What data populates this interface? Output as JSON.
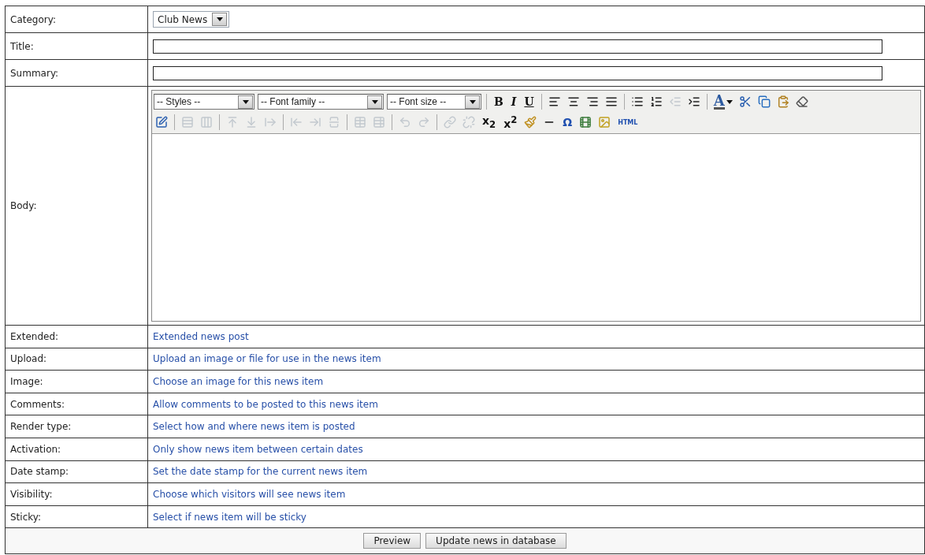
{
  "form": {
    "rows": [
      {
        "kind": "select",
        "label": "Category:",
        "value": "Club News"
      },
      {
        "kind": "input",
        "label": "Title:"
      },
      {
        "kind": "input",
        "label": "Summary:"
      },
      {
        "kind": "editor",
        "label": "Body:"
      },
      {
        "kind": "link",
        "label": "Extended:",
        "link": "Extended news post"
      },
      {
        "kind": "link",
        "label": "Upload:",
        "link": "Upload an image or file for use in the news item"
      },
      {
        "kind": "link",
        "label": "Image:",
        "link": "Choose an image for this news item"
      },
      {
        "kind": "link",
        "label": "Comments:",
        "link": "Allow comments to be posted to this news item"
      },
      {
        "kind": "link",
        "label": "Render type:",
        "link": "Select how and where news item is posted"
      },
      {
        "kind": "link",
        "label": "Activation:",
        "link": "Only show news item between certain dates"
      },
      {
        "kind": "link",
        "label": "Date stamp:",
        "link": "Set the date stamp for the current news item"
      },
      {
        "kind": "link",
        "label": "Visibility:",
        "link": "Choose which visitors will see news item"
      },
      {
        "kind": "link",
        "label": "Sticky:",
        "link": "Select if news item will be sticky"
      }
    ]
  },
  "editor_toolbar": {
    "button_groups": [
      [
        {
          "kind": "select",
          "label": "-- Styles --"
        },
        {
          "kind": "select",
          "label": "-- Font family --"
        },
        {
          "kind": "select",
          "label": "-- Font size --"
        },
        {
          "kind": "separator"
        },
        {
          "kind": "text",
          "label": "B",
          "disabled": false
        },
        {
          "kind": "text",
          "label": "I",
          "disabled": false
        },
        {
          "kind": "text",
          "label": "U",
          "disabled": false
        },
        {
          "kind": "separator"
        },
        {
          "kind": "icon",
          "disabled": false
        },
        {
          "kind": "icon",
          "disabled": false
        },
        {
          "kind": "icon",
          "disabled": false
        },
        {
          "kind": "icon",
          "disabled": false
        },
        {
          "kind": "separator"
        },
        {
          "kind": "icon",
          "disabled": false
        },
        {
          "kind": "icon",
          "disabled": false
        },
        {
          "kind": "icon",
          "disabled": true
        },
        {
          "kind": "icon",
          "disabled": false
        },
        {
          "kind": "separator"
        },
        {
          "kind": "color",
          "label": "A",
          "disabled": false
        },
        {
          "kind": "icon",
          "disabled": false
        },
        {
          "kind": "icon",
          "disabled": false
        },
        {
          "kind": "icon",
          "disabled": false
        },
        {
          "kind": "icon",
          "disabled": false
        }
      ],
      [
        {
          "kind": "icon",
          "disabled": false
        },
        {
          "kind": "separator"
        },
        {
          "kind": "icon",
          "disabled": true
        },
        {
          "kind": "icon",
          "disabled": true
        },
        {
          "kind": "separator"
        },
        {
          "kind": "icon",
          "disabled": true
        },
        {
          "kind": "icon",
          "disabled": true
        },
        {
          "kind": "icon",
          "disabled": true
        },
        {
          "kind": "separator"
        },
        {
          "kind": "icon",
          "disabled": true
        },
        {
          "kind": "icon",
          "disabled": true
        },
        {
          "kind": "icon",
          "disabled": true
        },
        {
          "kind": "separator"
        },
        {
          "kind": "icon",
          "disabled": true
        },
        {
          "kind": "icon",
          "disabled": true
        },
        {
          "kind": "separator"
        },
        {
          "kind": "icon",
          "disabled": true
        },
        {
          "kind": "icon",
          "disabled": true
        },
        {
          "kind": "separator"
        },
        {
          "kind": "icon",
          "disabled": true
        },
        {
          "kind": "icon",
          "disabled": true
        },
        {
          "kind": "text",
          "label": "x$_{2}$",
          "disabled": false
        },
        {
          "kind": "text",
          "label": "x$^{2}$",
          "disabled": false
        },
        {
          "kind": "icon",
          "disabled": false
        },
        {
          "kind": "icon",
          "disabled": false
        },
        {
          "kind": "text",
          "label": "Ω",
          "disabled": false
        },
        {
          "kind": "icon",
          "disabled": false
        },
        {
          "kind": "icon",
          "disabled": false
        },
        {
          "kind": "text",
          "label": "HTML",
          "disabled": false
        }
      ]
    ]
  },
  "buttons": [
    "Preview",
    "Update news in database"
  ]
}
